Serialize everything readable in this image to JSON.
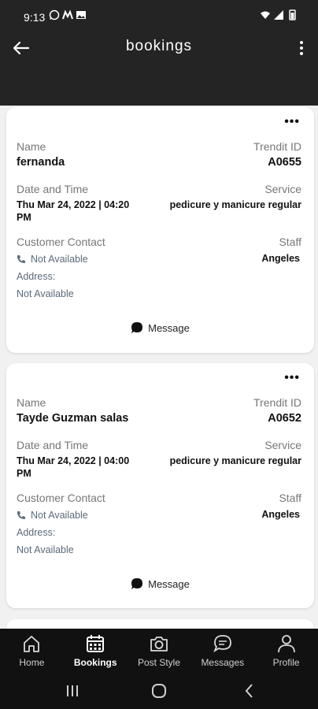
{
  "status_bar": {
    "time": "9:13"
  },
  "header": {
    "title": "bookings"
  },
  "bookings": [
    {
      "name_label": "Name",
      "name": "fernanda",
      "id_label": "Trendit ID",
      "id": "A0655",
      "datetime_label": "Date and Time",
      "datetime_line1": "Thu Mar 24, 2022 | 04:20",
      "datetime_line2": "PM",
      "service_label": "Service",
      "service": "pedicure y manicure regular",
      "contact_label": "Customer Contact",
      "phone": "Not Available",
      "address_label": "Address:",
      "address": "Not Available",
      "staff_label": "Staff",
      "staff": "Angeles",
      "message_label": "Message"
    },
    {
      "name_label": "Name",
      "name": "Tayde Guzman salas",
      "id_label": "Trendit ID",
      "id": "A0652",
      "datetime_label": "Date and Time",
      "datetime_line1": "Thu Mar 24, 2022 | 04:00",
      "datetime_line2": "PM",
      "service_label": "Service",
      "service": "pedicure y manicure regular",
      "contact_label": "Customer Contact",
      "phone": "Not Available",
      "address_label": "Address:",
      "address": "Not Available",
      "staff_label": "Staff",
      "staff": "Angeles",
      "message_label": "Message"
    }
  ],
  "bottom_nav": [
    {
      "label": "Home",
      "icon": "home-icon",
      "active": false
    },
    {
      "label": "Bookings",
      "icon": "calendar-icon",
      "active": true
    },
    {
      "label": "Post Style",
      "icon": "camera-icon",
      "active": false
    },
    {
      "label": "Messages",
      "icon": "messages-icon",
      "active": false
    },
    {
      "label": "Profile",
      "icon": "profile-icon",
      "active": false
    }
  ],
  "colors": {
    "header_bg": "#242424",
    "content_bg": "#f1f1f1",
    "nav_bg": "#111111",
    "contact_text": "#5a6b7b"
  }
}
